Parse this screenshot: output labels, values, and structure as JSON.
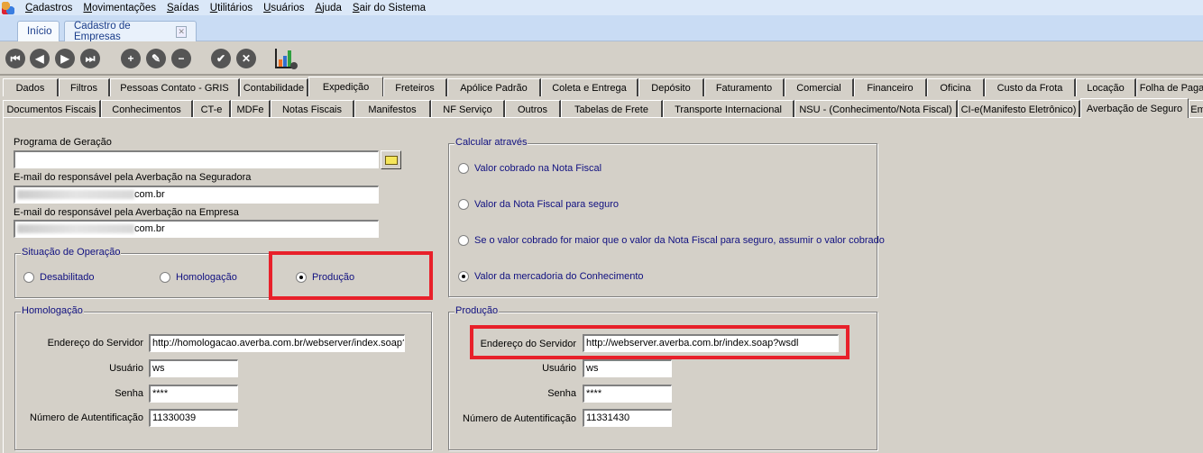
{
  "menu": [
    "Cadastros",
    "Movimentações",
    "Saídas",
    "Utilitários",
    "Usuários",
    "Ajuda",
    "Sair do Sistema"
  ],
  "doc_tabs": {
    "home": "Início",
    "current": "Cadastro de Empresas"
  },
  "toolbar": [
    "first-icon",
    "prev-icon",
    "next-icon",
    "last-icon",
    "add-icon",
    "edit-icon",
    "remove-icon",
    "confirm-icon",
    "cancel-icon",
    "chart-settings-icon"
  ],
  "tabs_row1": [
    "Dados",
    "Filtros",
    "Pessoas Contato - GRIS",
    "Contabilidade",
    "Expedição",
    "Freteiros",
    "Apólice Padrão",
    "Coleta e Entrega",
    "Depósito",
    "Faturamento",
    "Comercial",
    "Financeiro",
    "Oficina",
    "Custo da Frota",
    "Locação",
    "Folha de Paga"
  ],
  "tabs_row2": [
    "Documentos Fiscais",
    "Conhecimentos",
    "CT-e",
    "MDFe",
    "Notas Fiscais",
    "Manifestos",
    "NF Serviço",
    "Outros",
    "Tabelas de Frete",
    "Transporte Internacional",
    "NSU - (Conhecimento/Nota Fiscal)",
    "CI-e(Manifesto Eletrônico)",
    "Averbação de Seguro",
    "Em"
  ],
  "form": {
    "programa_label": "Programa de Geração",
    "programa_value": "",
    "email_seg_label": "E-mail do responsável pela Averbação na Seguradora",
    "email_seg_value": "com.br",
    "email_emp_label": "E-mail do responsável pela Averbação na Empresa",
    "email_emp_value": "com.br",
    "situacao": {
      "title": "Situação de Operação",
      "options": [
        "Desabilitado",
        "Homologação",
        "Produção"
      ],
      "selected": "Produção"
    },
    "calcular": {
      "title": "Calcular através",
      "options": [
        "Valor cobrado na Nota Fiscal",
        "Valor da Nota Fiscal para seguro",
        "Se o valor cobrado for maior que o valor da Nota Fiscal para seguro, assumir o valor cobrado",
        "Valor da mercadoria do Conhecimento"
      ],
      "selected": "Valor da mercadoria do Conhecimento"
    },
    "homologacao": {
      "title": "Homologação",
      "server_label": "Endereço do Servidor",
      "server": "http://homologacao.averba.com.br/webserver/index.soap?",
      "user_label": "Usuário",
      "user": "ws",
      "pass_label": "Senha",
      "pass": "****",
      "auth_label": "Número de Autentificação",
      "auth": "11330039"
    },
    "producao": {
      "title": "Produção",
      "server_label": "Endereço do Servidor",
      "server": "http://webserver.averba.com.br/index.soap?wsdl",
      "user_label": "Usuário",
      "user": "ws",
      "pass_label": "Senha",
      "pass": "****",
      "auth_label": "Número de Autentificação",
      "auth": "11331430"
    }
  },
  "colors": {
    "highlight": "#e8202a",
    "group_title": "#101080",
    "background": "#d4d0c8"
  }
}
